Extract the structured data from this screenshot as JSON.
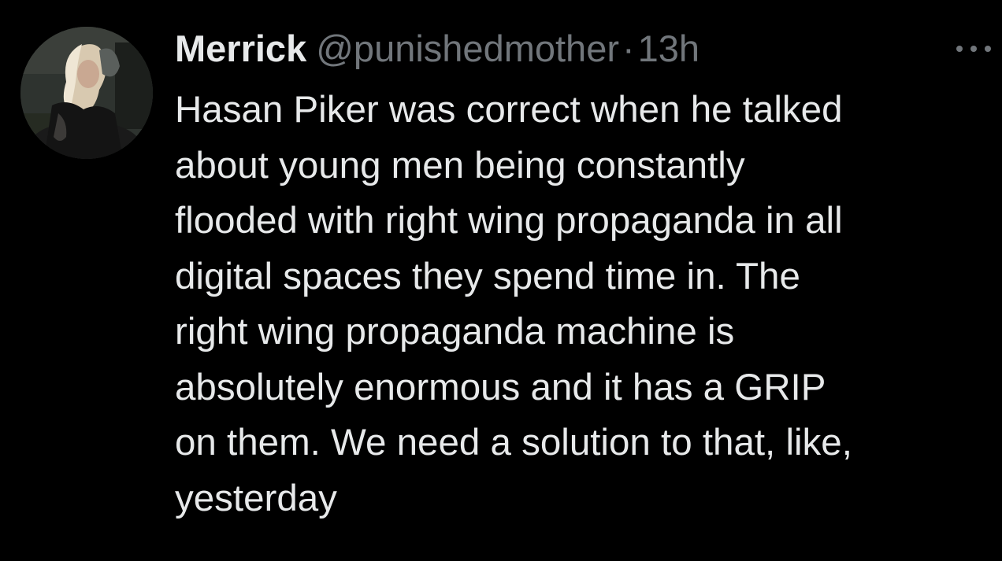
{
  "tweet": {
    "author": {
      "display_name": "Merrick",
      "handle": "@punishedmother",
      "separator": "·",
      "timestamp": "13h",
      "avatar": "profile-photo"
    },
    "more_icon": "more-horizontal-icon",
    "body_lines": [
      "Hasan Piker was correct when he talked",
      "about young men being constantly",
      "flooded with right wing propaganda in all",
      "digital spaces they spend time in. The",
      "right wing propaganda machine is",
      "absolutely enormous and it has a GRIP",
      "on them. We need a solution to that, like,",
      "yesterday"
    ]
  },
  "colors": {
    "background": "#000000",
    "primary_text": "#e7e9ea",
    "secondary_text": "#71767b"
  }
}
